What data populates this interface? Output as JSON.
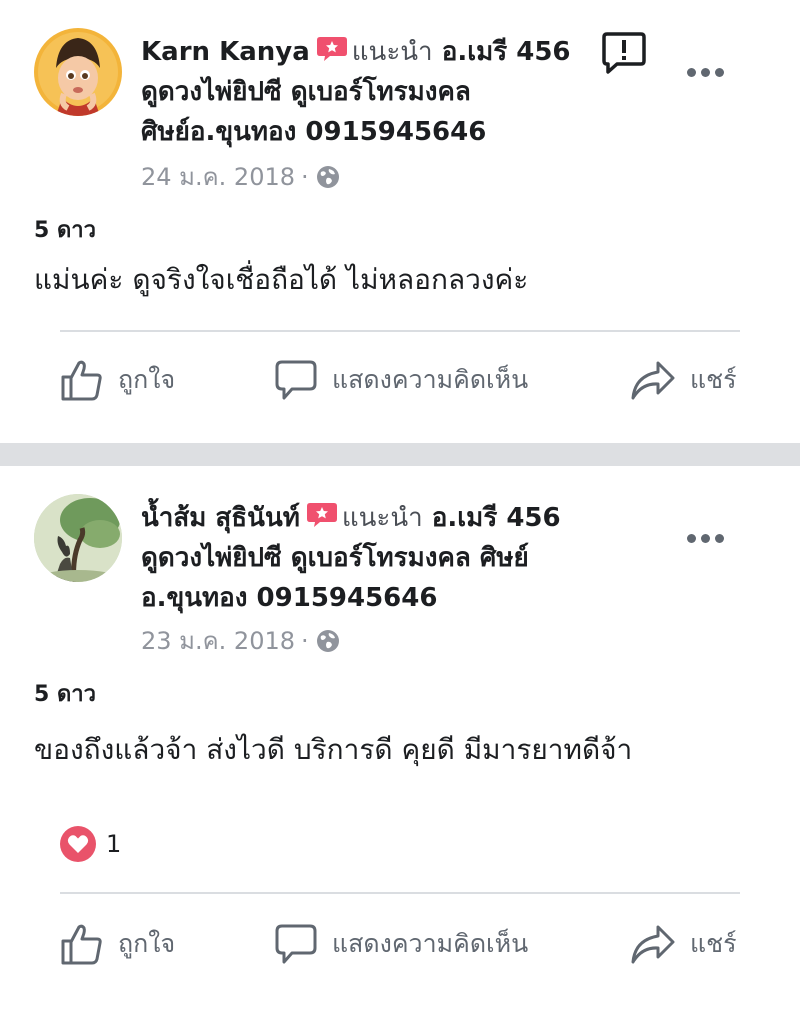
{
  "posts": [
    {
      "author": "Karn Kanya",
      "recommends_label": "แนะนำ",
      "page_name_l1": "อ.เมรี 456",
      "page_name_l2": "ดูดวงไพ่ยิปซี ดูเบอร์โทรมงคล",
      "page_name_l3": "ศิษย์อ.ขุนทอง 0915945646",
      "date": "24 ม.ค. 2018",
      "separator": "·",
      "rating": "5 ดาว",
      "review_text": "แม่นค่ะ ดูจริงใจเชื่อถือได้ ไม่หลอกลวงค่ะ"
    },
    {
      "author": "น้ำส้ม สุธินันท์",
      "recommends_label": "แนะนำ",
      "page_name_l1": "อ.เมรี 456",
      "page_name_l2": "ดูดวงไพ่ยิปซี ดูเบอร์โทรมงคล ศิษย์",
      "page_name_l3": "อ.ขุนทอง 0915945646",
      "date": "23 ม.ค. 2018",
      "separator": "·",
      "rating": "5 ดาว",
      "review_text": "ของถึงแล้วจ้า ส่งไวดี บริการดี คุยดี มีมารยาทดีจ้า",
      "reaction_count": "1"
    }
  ],
  "actions": {
    "like": "ถูกใจ",
    "comment": "แสดงความคิดเห็น",
    "share": "แชร์"
  },
  "icons": {
    "recommend": "recommend-badge-icon",
    "globe": "globe-icon",
    "report": "report-icon",
    "more": "more-options-icon",
    "like": "thumbs-up-icon",
    "comment": "comment-bubble-icon",
    "share": "share-arrow-icon",
    "love": "heart-icon"
  },
  "colors": {
    "badge": "#f0506e",
    "heart": "#e9536a",
    "text": "#1c1e21",
    "muted": "#606770",
    "divider": "#dddfe2"
  }
}
